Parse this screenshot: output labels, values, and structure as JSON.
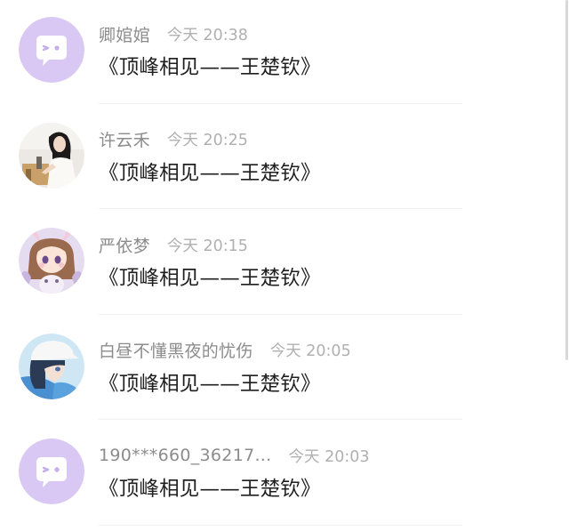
{
  "comments": [
    {
      "name": "卿婠婠",
      "time": "今天 20:38",
      "text": "《顶峰相见——王楚钦》",
      "avatar": "default-chat-avatar"
    },
    {
      "name": "许云禾",
      "time": "今天 20:25",
      "text": "《顶峰相见——王楚钦》",
      "avatar": "photo-woman-avatar"
    },
    {
      "name": "严依梦",
      "time": "今天 20:15",
      "text": "《顶峰相见——王楚钦》",
      "avatar": "anime-girl-bunny-avatar"
    },
    {
      "name": "白昼不懂黑夜的忧伤",
      "time": "今天 20:05",
      "text": "《顶峰相见——王楚钦》",
      "avatar": "anime-girl-cap-avatar"
    },
    {
      "name": "190***660_36217...",
      "time": "今天 20:03",
      "text": "《顶峰相见——王楚钦》",
      "avatar": "default-chat-avatar"
    }
  ],
  "colors": {
    "default_avatar_bg": "#d9c8f3",
    "name_text": "#8c8c8c",
    "time_text": "#b0b0b0",
    "body_text": "#1f1f1f"
  }
}
